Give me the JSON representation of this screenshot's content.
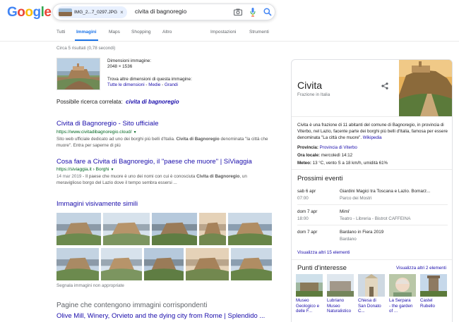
{
  "colors": {
    "link": "#1a0dab",
    "url": "#006621",
    "accent": "#1a73e8",
    "muted": "#70757a"
  },
  "logo": {
    "letters": [
      "G",
      "o",
      "o",
      "g",
      "l",
      "e"
    ]
  },
  "search": {
    "chip_filename": "IMG_2...7_0297.JPG",
    "chip_close": "×",
    "query": "civita di bagnoregio",
    "icons": [
      "camera-icon",
      "microphone-icon",
      "search-icon"
    ]
  },
  "tabs": {
    "all": "Tutti",
    "images": "Immagini",
    "maps": "Maps",
    "shopping": "Shopping",
    "more": "Altro",
    "settings": "Impostazioni",
    "tools": "Strumenti"
  },
  "stats": "Circa 5 risultati (0,78 secondi)",
  "image_info": {
    "dims_label": "Dimensioni immagine:",
    "dims_value": "2048 × 1536",
    "other_sizes": "Trova altre dimensioni di questa immagine:",
    "size_all": "Tutte le dimensioni",
    "size_sep1": " - ",
    "size_medium": "Medie",
    "size_sep2": " - ",
    "size_large": "Grandi"
  },
  "related": {
    "label": "Possibile ricerca correlata:",
    "query": "civita di bagnoregio"
  },
  "results": [
    {
      "title": "Civita di Bagnoregio - Sito ufficiale",
      "url": "https://www.civitadibagnoregio.cloud/",
      "snippet_1": "Sito web ufficiale dedicato ad uno dei borghi più belli d'Italia. ",
      "snippet_bold": "Civita di Bagnoregio",
      "snippet_2": " denominata \"la città che muore\". Entra per saperne di più"
    },
    {
      "title": "Cosa fare a Civita di Bagnoregio, il \"paese che muore\" | SiViaggia",
      "url": "https://siviaggia.it › Borghi",
      "date": "14 mar 2019",
      "snippet_1": " - Il paese che muore è uno dei nomi con cui è conosciuta ",
      "snippet_bold": "Civita di Bagnoregio",
      "snippet_2": ", un meraviglioso borgo del Lazio dove il tempo sembra essersi ..."
    }
  ],
  "similar": {
    "title": "Immagini visivamente simili",
    "report": "Segnala immagini non appropriate"
  },
  "pages": {
    "title": "Pagine che contengono immagini corrispondenti",
    "link": "Olive Mill, Winery, Orvieto and the dying city from Rome | Splendido ..."
  },
  "panel": {
    "title": "Civita",
    "subtitle": "Frazione in Italia",
    "description": "Civita è una frazione di 11 abitanti del comune di Bagnoregio, in provincia di Viterbo, nel Lazio, facente parte dei borghi più belli d'Italia, famosa per essere denominata \"La città che muore\". ",
    "description_link": "Wikipedia",
    "facts": [
      {
        "label": "Provincia:",
        "value": "",
        "link": "Provincia di Viterbo"
      },
      {
        "label": "Ora locale:",
        "value": "mercoledì 14:12",
        "link": ""
      },
      {
        "label": "Meteo:",
        "value": "13 °C, vento S a 18 km/h, umidità 61%",
        "link": ""
      }
    ],
    "events_title": "Prossimi eventi",
    "events": [
      {
        "date": "sab 6 apr",
        "time": "07:00",
        "name": "Giardini Magici tra Toscana e Lazio. Bomarz...",
        "place": "Parco dei Mostri"
      },
      {
        "date": "dom 7 apr",
        "time": "18:00",
        "name": "Mimi'",
        "place": "Teatro - Libreria - Bistrot CAFFEINA"
      },
      {
        "date": "dom 7 apr",
        "time": "",
        "name": "Bardano in Fiera 2019",
        "place": "Bardano"
      }
    ],
    "events_more": "Visualizza altri 15 elementi",
    "poi_title": "Punti d'interesse",
    "poi_more": "Visualizza altri 2 elementi",
    "poi": [
      {
        "line1": "Museo",
        "line2": "Geologico e",
        "line3": "delle F..."
      },
      {
        "line1": "Lubriano",
        "line2": "Museo",
        "line3": "Naturalistico"
      },
      {
        "line1": "Chiesa di",
        "line2": "San Donato",
        "line3": "C..."
      },
      {
        "line1": "La Serpara",
        "line2": "- the garden",
        "line3": "of ..."
      },
      {
        "line1": "Castel",
        "line2": "Rubello",
        "line3": ""
      }
    ]
  }
}
